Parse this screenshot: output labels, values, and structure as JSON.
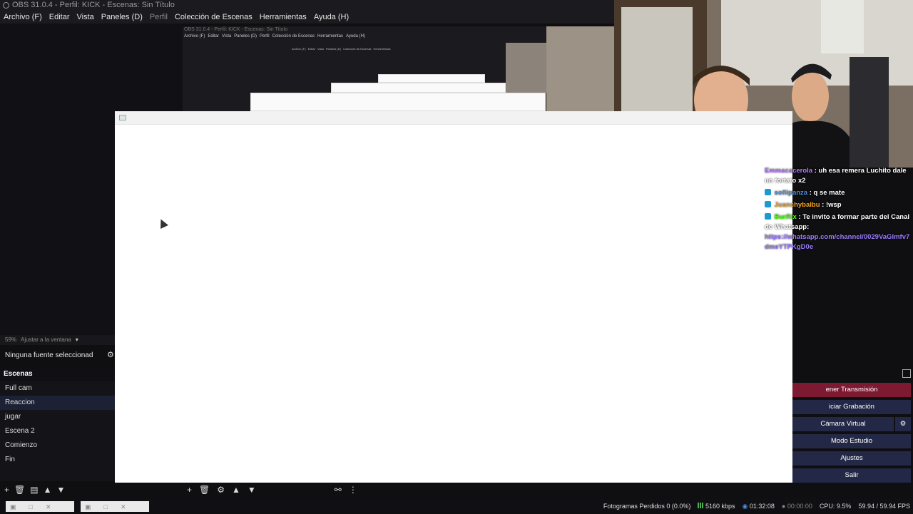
{
  "window": {
    "title": "OBS 31.0.4 - Perfil: KICK - Escenas: Sin Título",
    "menu": [
      "Archivo (F)",
      "Editar",
      "Vista",
      "Paneles (D)",
      "Perfil",
      "Colección de Escenas",
      "Herramientas",
      "Ayuda (H)"
    ]
  },
  "nested": {
    "title": "OBS 31.0.4 - Perfil: KICK - Escenas: Sin Título",
    "menu": [
      "Archivo (F)",
      "Editar",
      "Vista",
      "Paneles (D)",
      "Perfil",
      "Colección de Escenas",
      "Herramientas",
      "Ayuda (H)"
    ]
  },
  "chat": {
    "lines": [
      {
        "user": "Emmacacerola",
        "msg": ": uh esa remera Luchito dale un fortato x2"
      },
      {
        "user": "sofiipanza",
        "msg": ": q se mate"
      },
      {
        "user": "Juanchybalbu",
        "msg": ": !wsp"
      },
      {
        "user": "BurRix",
        "msg": ": Te invito a formar parte del Canal de Whatsapp:"
      },
      {
        "user": "",
        "msg": "https://whatsapp.com/channel/0029VaGlmfv7dmeYTPKgD0e"
      }
    ]
  },
  "preview": {
    "zoom": "59%",
    "fit_label": "Ajustar a la ventana"
  },
  "sources": {
    "empty_label": "Ninguna fuente seleccionad"
  },
  "scenes": {
    "header": "Escenas",
    "items": [
      "Full cam",
      "Reaccion",
      "jugar",
      "Escena 2",
      "Comienzo",
      "Fin"
    ],
    "active_index": 1
  },
  "controls": {
    "stop_stream": "ener Transmisión",
    "start_record": "iciar Grabación",
    "virtual_cam": "Cámara Virtual",
    "studio_mode": "Modo Estudio",
    "settings": "Ajustes",
    "exit": "Salir"
  },
  "status": {
    "dropped_frames": "Fotogramas Perdidos 0 (0.0%)",
    "bitrate": "5160 kbps",
    "stream_time": "01:32:08",
    "record_time": "00:00:00",
    "cpu": "CPU: 9.5%",
    "fps": "59.94 / 59.94 FPS"
  }
}
